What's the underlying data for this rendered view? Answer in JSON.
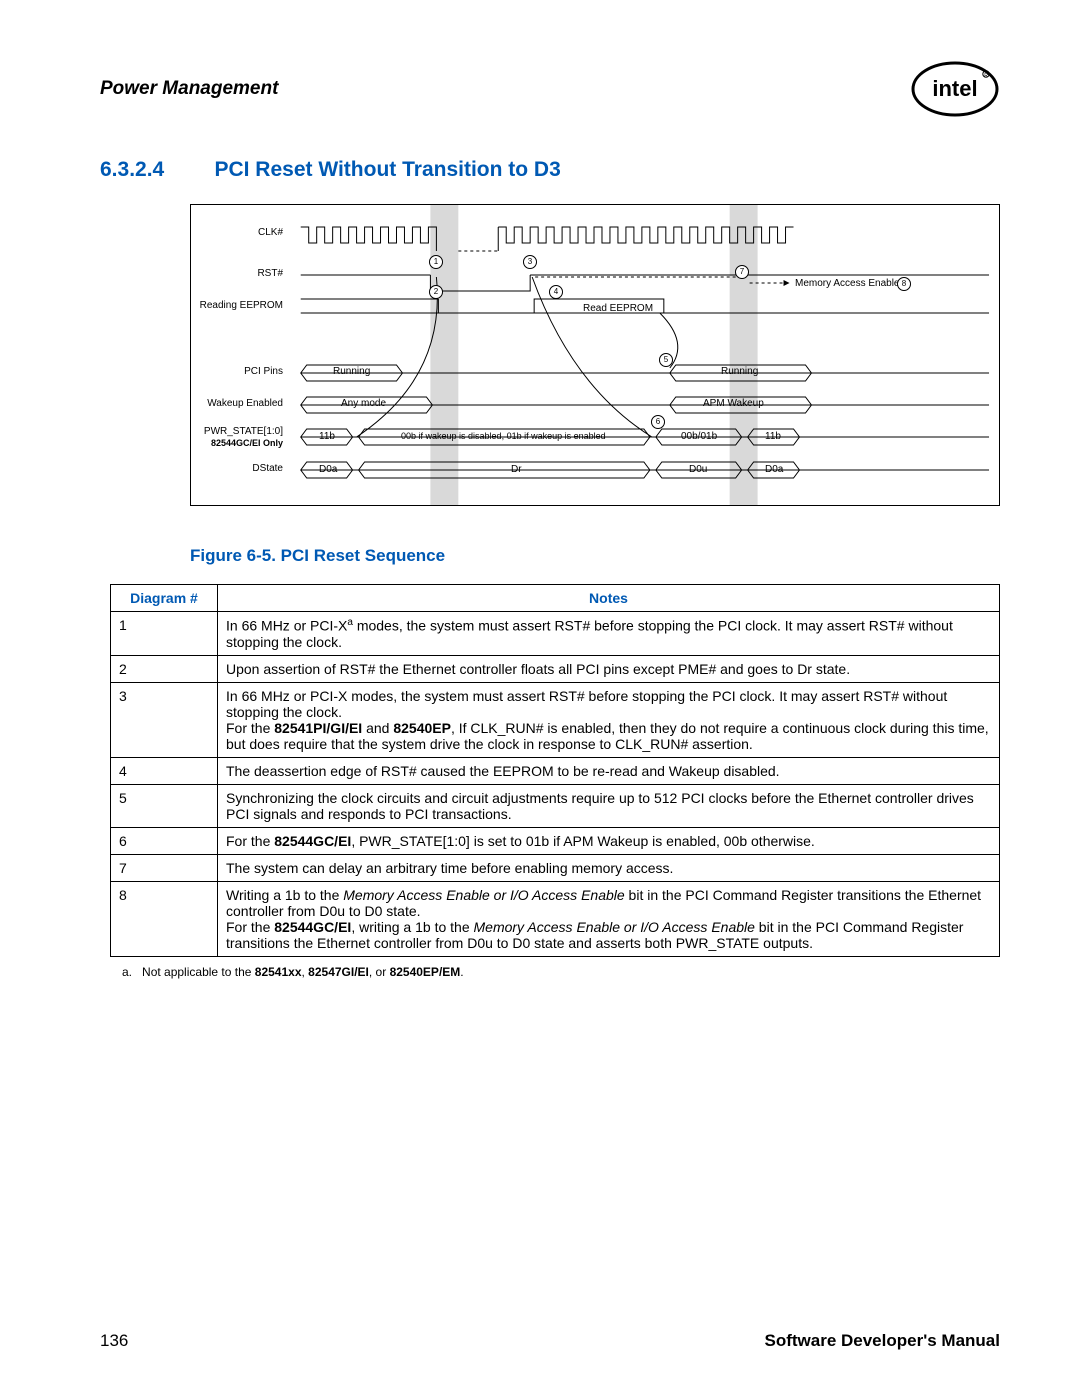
{
  "header": {
    "section_title": "Power Management"
  },
  "section": {
    "number": "6.3.2.4",
    "title": "PCI Reset Without Transition to D3"
  },
  "diagram": {
    "signals": {
      "clk": "CLK#",
      "rst": "RST#",
      "reading_eeprom": "Reading EEPROM",
      "pci_pins": "PCI Pins",
      "wakeup_enabled": "Wakeup Enabled",
      "pwr_state": "PWR_STATE[1:0]",
      "pwr_state_note": "82544GC/EI Only",
      "dstate": "DState"
    },
    "labels": {
      "memory_access_enable": "Memory Access Enable",
      "read_eeprom": "Read EEPROM",
      "running1": "Running",
      "running2": "Running",
      "any_mode": "Any mode",
      "apm_wakeup": "APM Wakeup",
      "pwr_11b_a": "11b",
      "pwr_mid": "00b if wakeup is disabled, 01b if wakeup is enabled",
      "pwr_00b01b": "00b/01b",
      "pwr_11b_b": "11b",
      "d0a_a": "D0a",
      "dr": "Dr",
      "d0u": "D0u",
      "d0a_b": "D0a"
    },
    "markers": {
      "m1": "1",
      "m2": "2",
      "m3": "3",
      "m4": "4",
      "m5": "5",
      "m6": "6",
      "m7": "7",
      "m8": "8"
    }
  },
  "figure_caption": "Figure 6-5. PCI Reset Sequence",
  "table": {
    "headers": {
      "diag": "Diagram #",
      "notes": "Notes"
    },
    "rows": [
      {
        "num": "1",
        "notes_html": "In 66 MHz or PCI-X<span class='sup'>a</span> modes, the system must assert RST# before stopping the PCI clock. It may assert RST# without stopping the clock."
      },
      {
        "num": "2",
        "notes_html": "Upon assertion of RST# the Ethernet controller floats all PCI pins except PME# and goes to Dr state."
      },
      {
        "num": "3",
        "notes_html": "In 66 MHz or PCI-X modes, the system must assert RST# before stopping the PCI clock. It may assert RST# without stopping the clock.<br>For the <span class='b'>82541PI/GI/EI</span> and <span class='b'>82540EP</span>, If CLK_RUN# is enabled, then they do not require a continuous clock during this time, but does require that the system drive the clock in response to CLK_RUN# assertion."
      },
      {
        "num": "4",
        "notes_html": "The deassertion edge of RST# caused the EEPROM to be re-read and Wakeup disabled."
      },
      {
        "num": "5",
        "notes_html": "Synchronizing the clock circuits and circuit adjustments require up to 512 PCI clocks before the Ethernet controller drives PCI signals and responds to PCI transactions."
      },
      {
        "num": "6",
        "notes_html": "For the <span class='b'>82544GC/EI</span>, PWR_STATE[1:0] is set to 01b if APM Wakeup is enabled, 00b otherwise."
      },
      {
        "num": "7",
        "notes_html": "The system can delay an arbitrary time before enabling memory access."
      },
      {
        "num": "8",
        "notes_html": "Writing a 1b to the <span class='ital'>Memory Access Enable or I/O Access Enable</span> bit in the PCI Command Register transitions the Ethernet controller from D0u to D0 state.<br>For the <span class='b'>82544GC/EI</span>, writing a 1b to the <span class='ital'>Memory Access Enable or I/O Access Enable</span> bit in the PCI Command Register transitions the Ethernet controller from D0u to D0 state and asserts both PWR_STATE outputs."
      }
    ]
  },
  "footnote": {
    "marker": "a.",
    "text_html": "Not applicable to the <span class='b'>82541xx</span>, <span class='b'>82547GI/EI</span>, or <span class='b'>82540EP/EM</span>."
  },
  "footer": {
    "page": "136",
    "doc": "Software Developer's Manual"
  }
}
